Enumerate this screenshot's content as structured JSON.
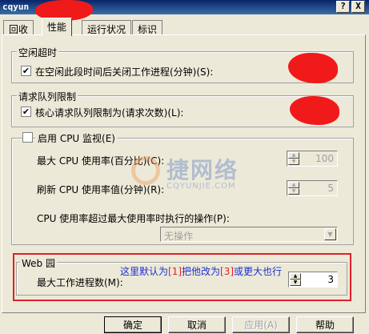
{
  "window": {
    "title": "cqyun",
    "help_glyph": "?",
    "close_glyph": "X"
  },
  "tabs": [
    {
      "label": "回收"
    },
    {
      "label": "性能"
    },
    {
      "label": "运行状况"
    },
    {
      "label": "标识"
    }
  ],
  "idle": {
    "title": "空闲超时",
    "checkbox_label": "在空闲此段时间后关闭工作进程(分钟)(S):",
    "checked": true
  },
  "queue": {
    "title": "请求队列限制",
    "checkbox_label": "核心请求队列限制为(请求次数)(L):",
    "checked": true
  },
  "cpu": {
    "title": "启用 CPU 监视(E)",
    "checked": false,
    "max_label": "最大 CPU 使用率(百分比)(C):",
    "max_value": "100",
    "refresh_label": "刷新 CPU 使用率值(分钟)(R):",
    "refresh_value": "5",
    "action_label": "CPU 使用率超过最大使用率时执行的操作(P):",
    "action_value": "无操作"
  },
  "web_garden": {
    "title": "Web 园",
    "max_processes_label": "最大工作进程数(M):",
    "max_processes_value": "3"
  },
  "note": {
    "part1": "这里默认为",
    "part2": "[1]",
    "part3": "把他改为",
    "part4": "[3]",
    "part5": "或更大也行"
  },
  "watermark": {
    "brand": "捷网络",
    "domain": "CQYUNJIE.COM"
  },
  "buttons": {
    "ok": "确定",
    "cancel": "取消",
    "apply": "应用(A)",
    "help": "帮助"
  },
  "colors": {
    "annotation": "#e0202a",
    "note_text": "#1a2fd0",
    "dialog_bg": "#ece9d8"
  }
}
